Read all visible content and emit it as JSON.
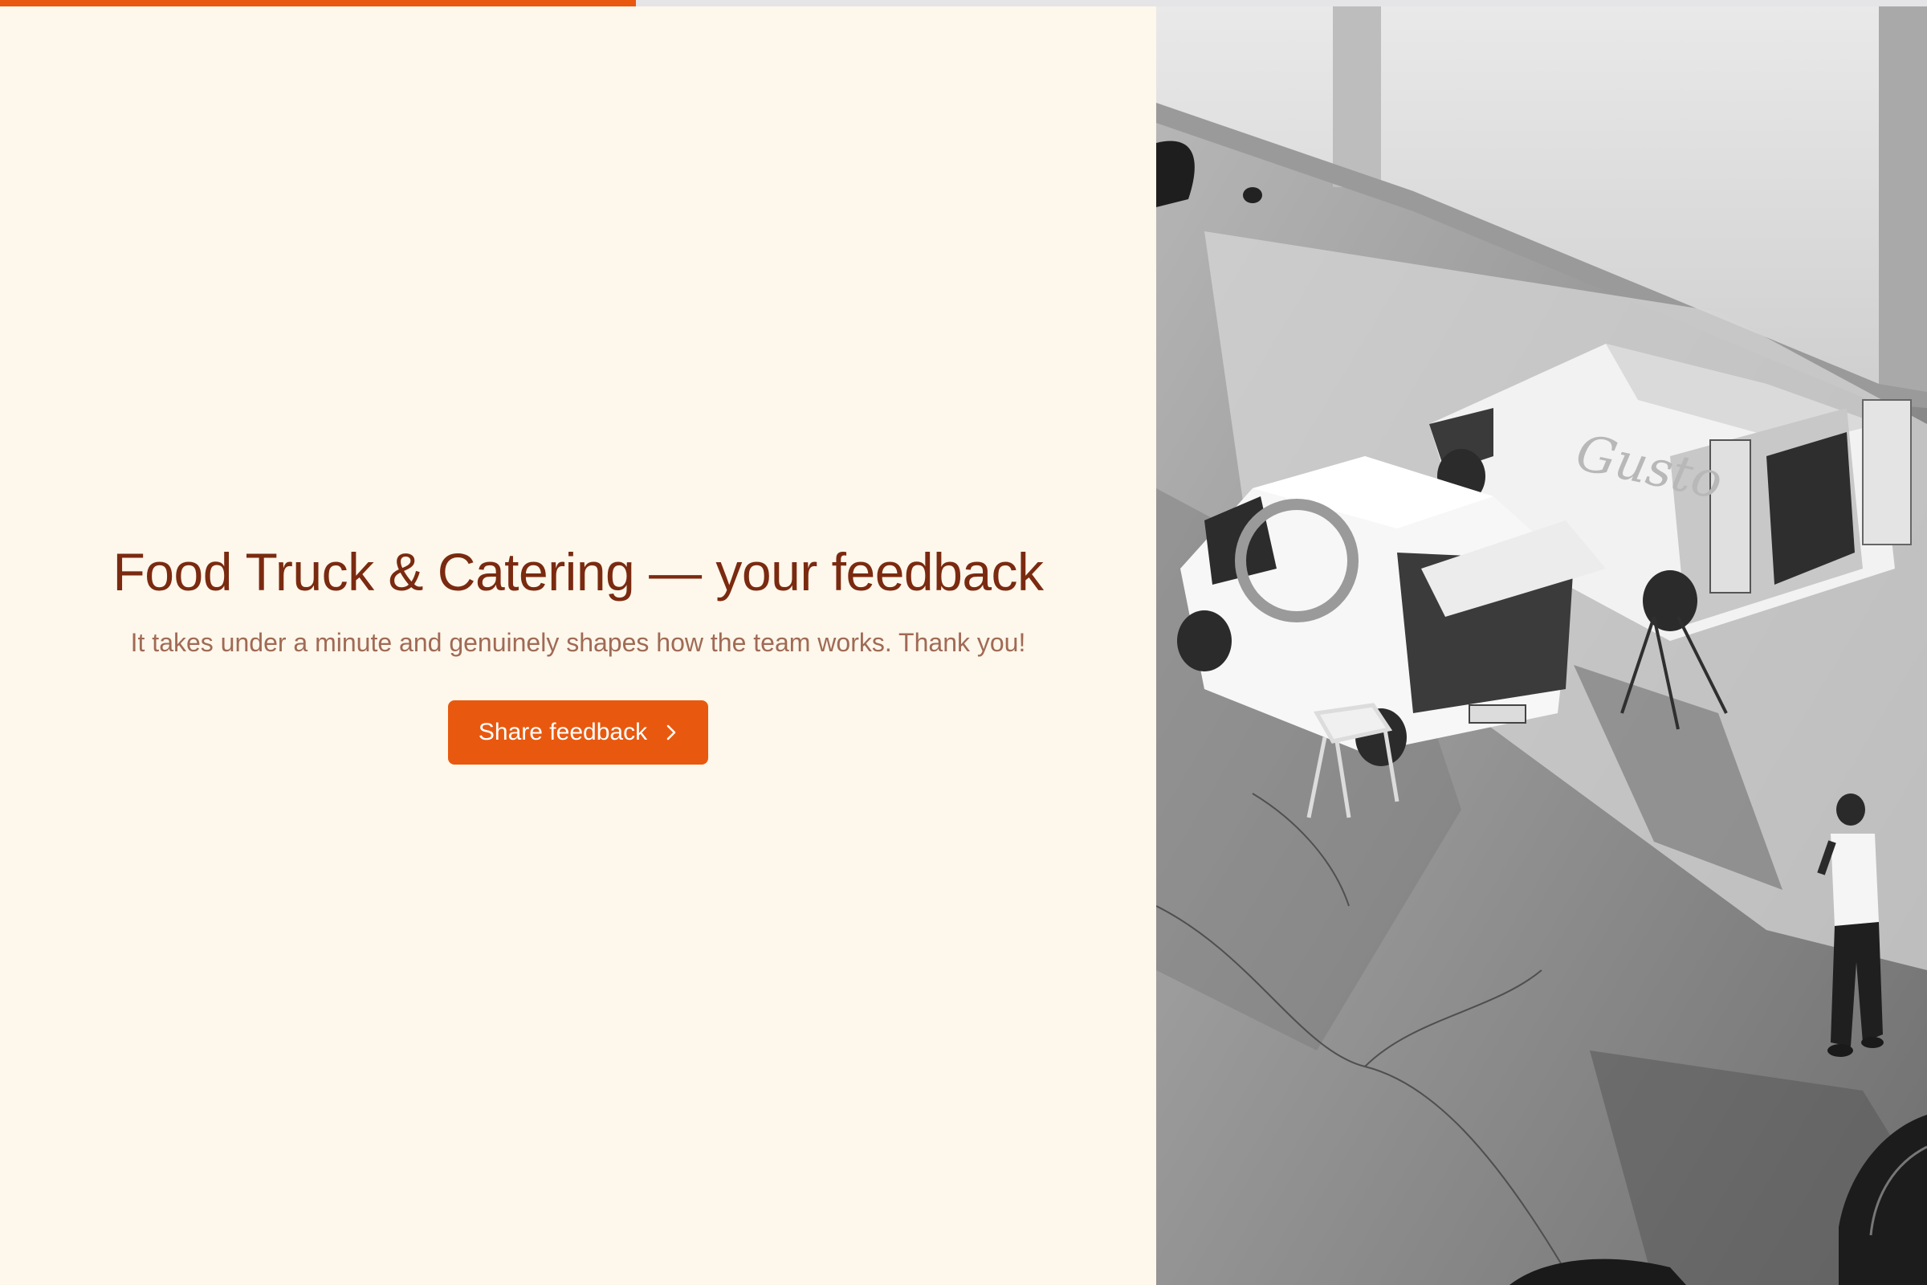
{
  "progress": {
    "fraction": 0.33,
    "track_color": "#E5E4E7",
    "fill_color": "#E8590F"
  },
  "welcome": {
    "title": "Food Truck & Catering — your feedback",
    "subtitle": "It takes under a minute and genuinely shapes how the team works. Thank you!",
    "cta_label": "Share feedback",
    "cta_icon": "chevron-right-icon"
  },
  "colors": {
    "background": "#FEF7EB",
    "title": "#7A2A10",
    "subtitle": "#A06A55",
    "accent": "#E8590F"
  },
  "hero_image": {
    "alt": "Black and white aerial photo of food trucks in a parking lot",
    "van_lettering": "Gusto"
  }
}
